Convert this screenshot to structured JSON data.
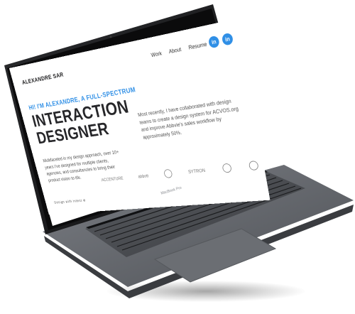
{
  "site": {
    "brand": "ALEXANDRE SAR",
    "nav": [
      "Work",
      "About",
      "Resume"
    ],
    "social": [
      "in",
      "in"
    ],
    "intro": "HI! I'M ALEXANDRE, A FULL-SPECTRUM",
    "headline_line1": "INTERACTION",
    "headline_line2": "DESIGNER",
    "paragraph_left": "Multifaceted in my design approach, over 10+ years I've designed for multiple clients, agencies, and consultancies to bring their product vision to life.",
    "paragraph_right": "Most recently, I have collaborated with design teams to create a design system for ACVOS.org and improve Abbvie's sales workflow by approximately 50%.",
    "logos": [
      "ACCENTURE",
      "abbott",
      "",
      "SYTRON",
      "",
      ""
    ],
    "cta": "Design with Intent ⊕"
  },
  "device": {
    "model_label": "MacBook Pro"
  }
}
